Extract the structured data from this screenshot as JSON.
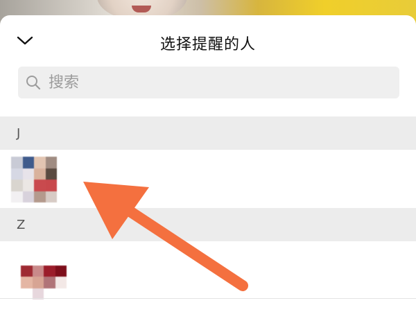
{
  "header": {
    "title": "选择提醒的人",
    "collapse_icon": "chevron-down-icon"
  },
  "search": {
    "placeholder": "搜索",
    "value": "",
    "icon": "search-icon"
  },
  "sections": [
    {
      "letter": "J"
    },
    {
      "letter": "Z"
    }
  ],
  "annotation": {
    "color": "#f4703f"
  }
}
